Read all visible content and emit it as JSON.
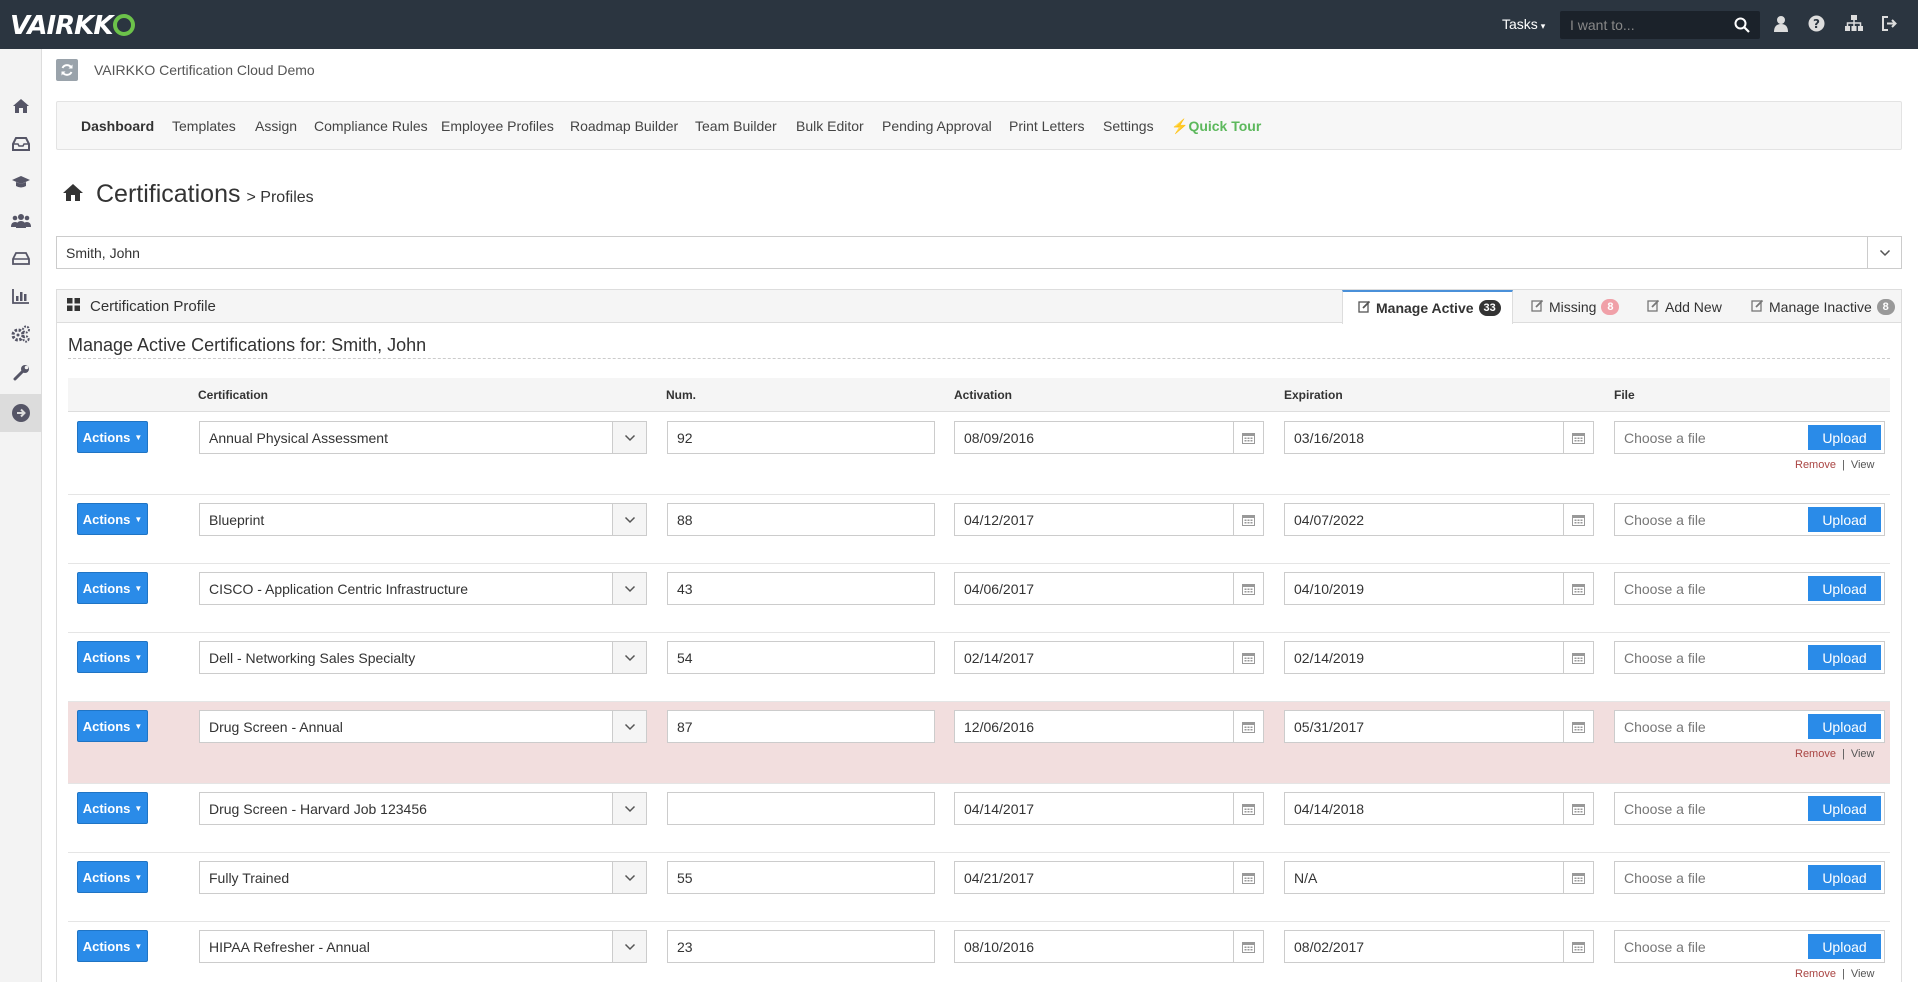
{
  "topbar": {
    "logo": "VAIRKK",
    "tasks_label": "Tasks",
    "search_placeholder": "I want to..."
  },
  "subheader": {
    "site_name": "VAIRKKO Certification Cloud Demo"
  },
  "menu": {
    "items": [
      "Dashboard",
      "Templates",
      "Assign",
      "Compliance Rules",
      "Employee Profiles",
      "Roadmap Builder",
      "Team Builder",
      "Bulk Editor",
      "Pending Approval",
      "Print Letters",
      "Settings"
    ],
    "quick_tour": "Quick Tour"
  },
  "page": {
    "title": "Certifications",
    "subtitle": "> Profiles"
  },
  "employee_select": {
    "value": "Smith, John"
  },
  "panel": {
    "title": "Certification Profile",
    "tabs": [
      {
        "label": "Manage Active",
        "count": "33"
      },
      {
        "label": "Missing",
        "count": "8"
      },
      {
        "label": "Add New"
      },
      {
        "label": "Manage Inactive",
        "count": "8"
      }
    ],
    "heading": "Manage Active Certifications for: Smith, John"
  },
  "table": {
    "headers": {
      "certification": "Certification",
      "num": "Num.",
      "activation": "Activation",
      "expiration": "Expiration",
      "file": "File"
    },
    "actions_label": "Actions",
    "file_placeholder": "Choose a file",
    "upload_label": "Upload",
    "remove_label": "Remove",
    "view_label": "View",
    "rows": [
      {
        "cert": "Annual Physical Assessment",
        "num": "92",
        "activation": "08/09/2016",
        "expiration": "03/16/2018"
      },
      {
        "cert": "Blueprint",
        "num": "88",
        "activation": "04/12/2017",
        "expiration": "04/07/2022"
      },
      {
        "cert": "CISCO - Application Centric Infrastructure",
        "num": "43",
        "activation": "04/06/2017",
        "expiration": "04/10/2019"
      },
      {
        "cert": "Dell - Networking Sales Specialty",
        "num": "54",
        "activation": "02/14/2017",
        "expiration": "02/14/2019"
      },
      {
        "cert": "Drug Screen - Annual",
        "num": "87",
        "activation": "12/06/2016",
        "expiration": "05/31/2017"
      },
      {
        "cert": "Drug Screen - Harvard Job 123456",
        "num": "",
        "activation": "04/14/2017",
        "expiration": "04/14/2018"
      },
      {
        "cert": "Fully Trained",
        "num": "55",
        "activation": "04/21/2017",
        "expiration": "N/A"
      },
      {
        "cert": "HIPAA Refresher - Annual",
        "num": "23",
        "activation": "08/10/2016",
        "expiration": "08/02/2017"
      }
    ]
  },
  "colors": {
    "topbar": "#2b3540",
    "accent": "#2a8be8",
    "brand_green": "#6cc24a",
    "expired_row": "#f2dede"
  }
}
